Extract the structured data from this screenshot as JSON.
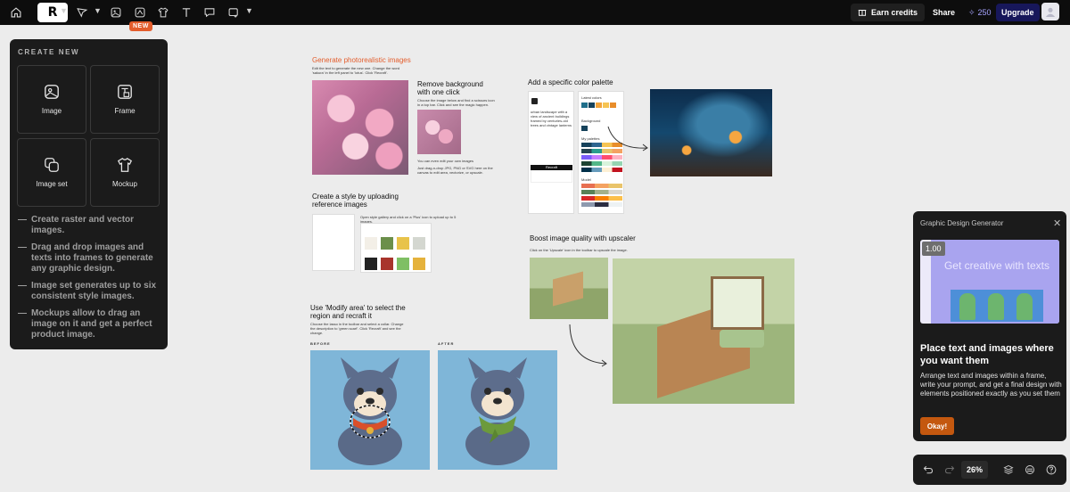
{
  "toolbar": {
    "new_badge": "NEW",
    "earn_credits": "Earn credits",
    "share": "Share",
    "credits_count": "250",
    "upgrade": "Upgrade"
  },
  "create_panel": {
    "heading": "CREATE NEW",
    "tiles": [
      {
        "label": "Image",
        "icon": "image-icon"
      },
      {
        "label": "Frame",
        "icon": "frame-icon"
      },
      {
        "label": "Image set",
        "icon": "image-set-icon"
      },
      {
        "label": "Mockup",
        "icon": "tshirt-icon"
      }
    ],
    "bullets": [
      "Create raster and vector images.",
      "Drag and drop images and texts into frames to generate any graphic design.",
      "Image set generates up to six consistent style images.",
      "Mockups allow to drag an image on it and get a perfect product image."
    ]
  },
  "canvas": {
    "gen_title": "Generate photorealistic images",
    "gen_desc": "Edit the text to generate the new one. Change the word 'sakura' in the left panel to 'lotus'. Click 'Recraft'.",
    "remove_title": "Remove background with one click",
    "remove_desc": "Choose the image below and find a scissors icon in a top bar. Click and see the magic happen.",
    "edit_note": "You can even edit your own images",
    "drag_note": "Just drag-n-drop JPG, PNG or SVG here on the canvas to edit area, vectorize, or upscale.",
    "palette_title": "Add a specific color palette",
    "palette_labels": [
      "Latest colors",
      "Background",
      "My palettes",
      "Model"
    ],
    "palette_prompt": "urban landscape with a view of ancient buildings framed by centuries-old trees and vintage lanterns",
    "recraft_btn": "Recraft",
    "style_title": "Create a style by uploading reference images",
    "style_desc": "Open style gallery and click on a 'Plus' icon to upload up to 5 images.",
    "upscale_title": "Boost image quality with upscaler",
    "upscale_desc": "Click on the 'Upscale' icon in the toolbar to upscale the image.",
    "modify_title": "Use 'Modify area' to select the region and recraft it",
    "modify_desc": "Choose the lasso in the toolbar and select a collar. Change the description to 'green scarf'. Click 'Recraft' and see the change.",
    "before_label": "BEFORE",
    "after_label": "AFTER"
  },
  "gd_panel": {
    "title": "Graphic Design Generator",
    "zoom_badge": "1.00",
    "preview_text": "Get creative with texts",
    "heading": "Place text and images where you want them",
    "body": "Arrange text and images within a frame, write your prompt, and get a final design with elements positioned exactly as you set them",
    "ok": "Okay!"
  },
  "bottom_bar": {
    "zoom": "26%"
  },
  "colors": {
    "accent_orange": "#e35d2c",
    "upgrade_bg": "#17175a",
    "credits_purple": "#a7a4ff",
    "ok_button": "#c4580f"
  }
}
